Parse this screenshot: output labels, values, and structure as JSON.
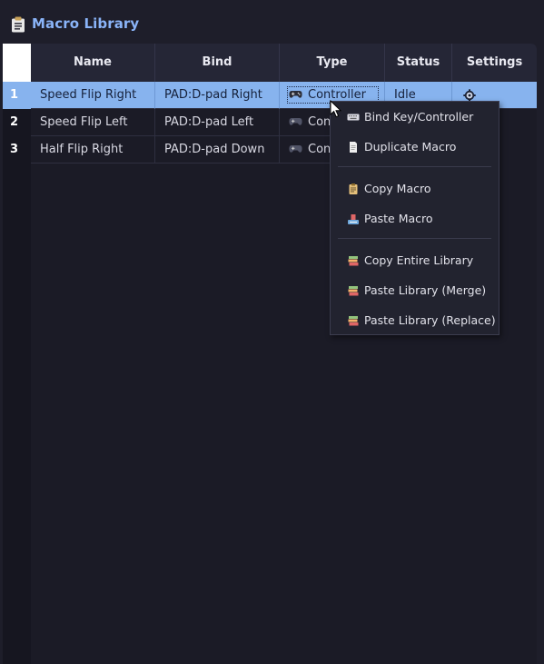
{
  "header": {
    "icon": "clipboard-icon",
    "title": "Macro Library",
    "title_color": "#8ab4f8"
  },
  "table": {
    "columns": [
      "Name",
      "Bind",
      "Type",
      "Status",
      "Settings"
    ],
    "rows": [
      {
        "num": "1",
        "name": "Speed Flip Right",
        "bind": "PAD:D-pad Right",
        "type": "Controller",
        "type_icon": "gamepad-icon",
        "status": "Idle",
        "settings_icon": "gear-icon",
        "selected": true
      },
      {
        "num": "2",
        "name": "Speed Flip Left",
        "bind": "PAD:D-pad Left",
        "type": "Con",
        "type_icon": "gamepad-icon",
        "status": "",
        "selected": false
      },
      {
        "num": "3",
        "name": "Half Flip Right",
        "bind": "PAD:D-pad Down",
        "type": "Con",
        "type_icon": "gamepad-icon",
        "status": "",
        "selected": false
      }
    ],
    "selection_color": "#87b3ee"
  },
  "context_menu": {
    "items": [
      {
        "label": "Bind Key/Controller",
        "icon": "keyboard-icon"
      },
      {
        "label": "Duplicate Macro",
        "icon": "document-icon"
      },
      {
        "label": "Copy Macro",
        "icon": "clipboard-icon"
      },
      {
        "label": "Paste Macro",
        "icon": "paste-icon"
      },
      {
        "label": "Copy Entire Library",
        "icon": "books-icon"
      },
      {
        "label": "Paste Library (Merge)",
        "icon": "books-icon"
      },
      {
        "label": "Paste Library (Replace)",
        "icon": "books-icon"
      }
    ]
  }
}
